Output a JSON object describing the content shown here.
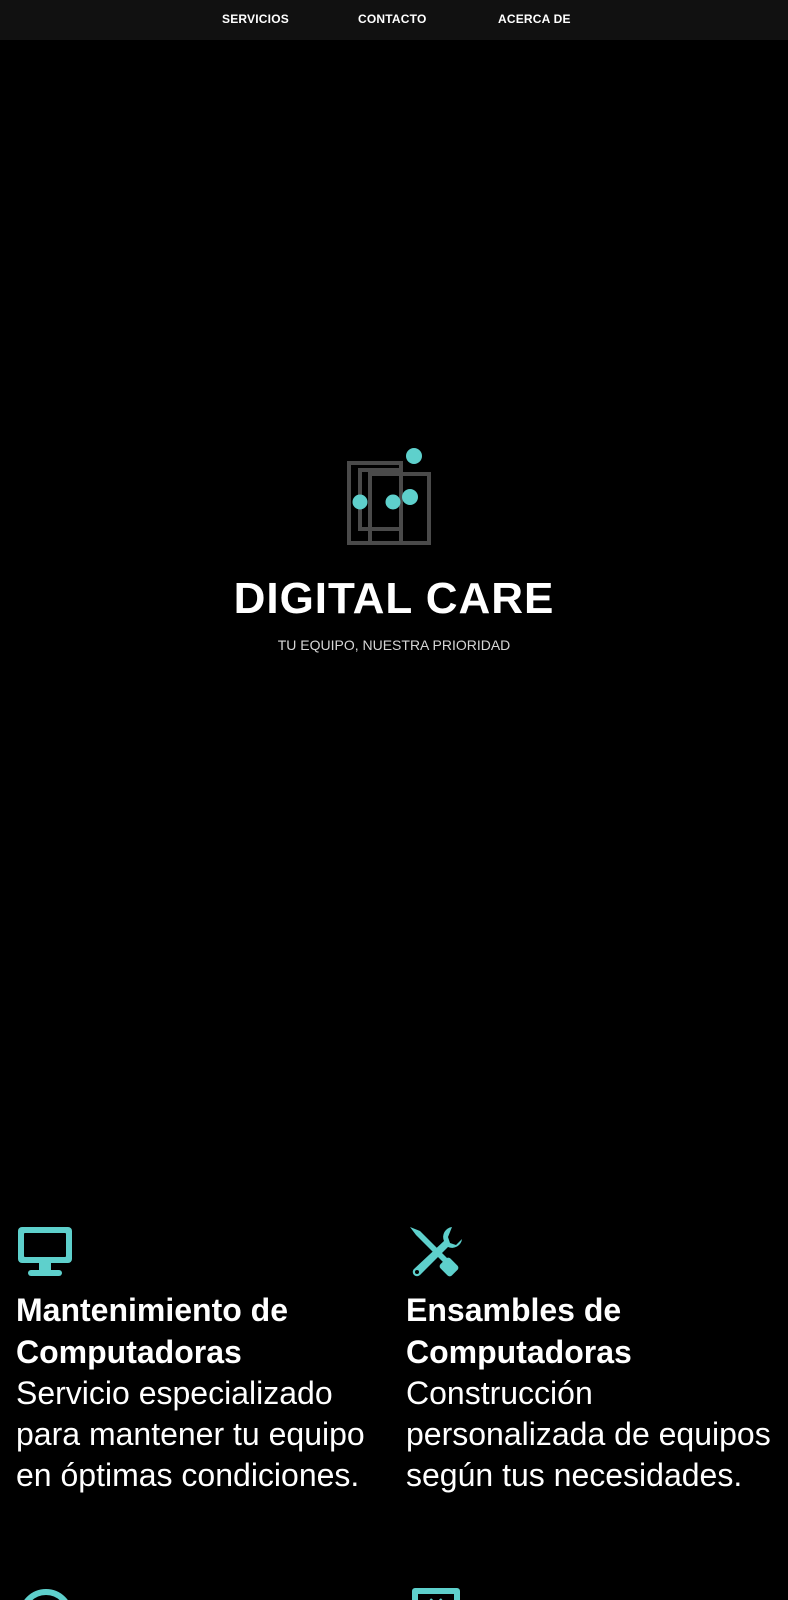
{
  "nav": {
    "items": [
      {
        "label": "SERVICIOS"
      },
      {
        "label": "CONTACTO"
      },
      {
        "label": "ACERCA DE"
      }
    ]
  },
  "hero": {
    "logo_icon": "circuit-squares-logo",
    "title": "DIGITAL CARE",
    "tagline": "TU EQUIPO, NUESTRA PRIORIDAD"
  },
  "services": [
    {
      "icon": "monitor-icon",
      "title": "Mantenimiento de Computadoras",
      "description": "Servicio especializado para mantener tu equipo en óptimas condiciones."
    },
    {
      "icon": "tools-icon",
      "title": "Ensambles de Computadoras",
      "description": "Construcción personalizada de equipos según tus necesidades."
    },
    {
      "icon": "headset-icon"
    },
    {
      "icon": "laptop-code-icon"
    }
  ],
  "colors": {
    "accent": "#5ed0cc",
    "background": "#000000",
    "nav_background": "#111111",
    "logo_gray": "#4a4a4a"
  }
}
